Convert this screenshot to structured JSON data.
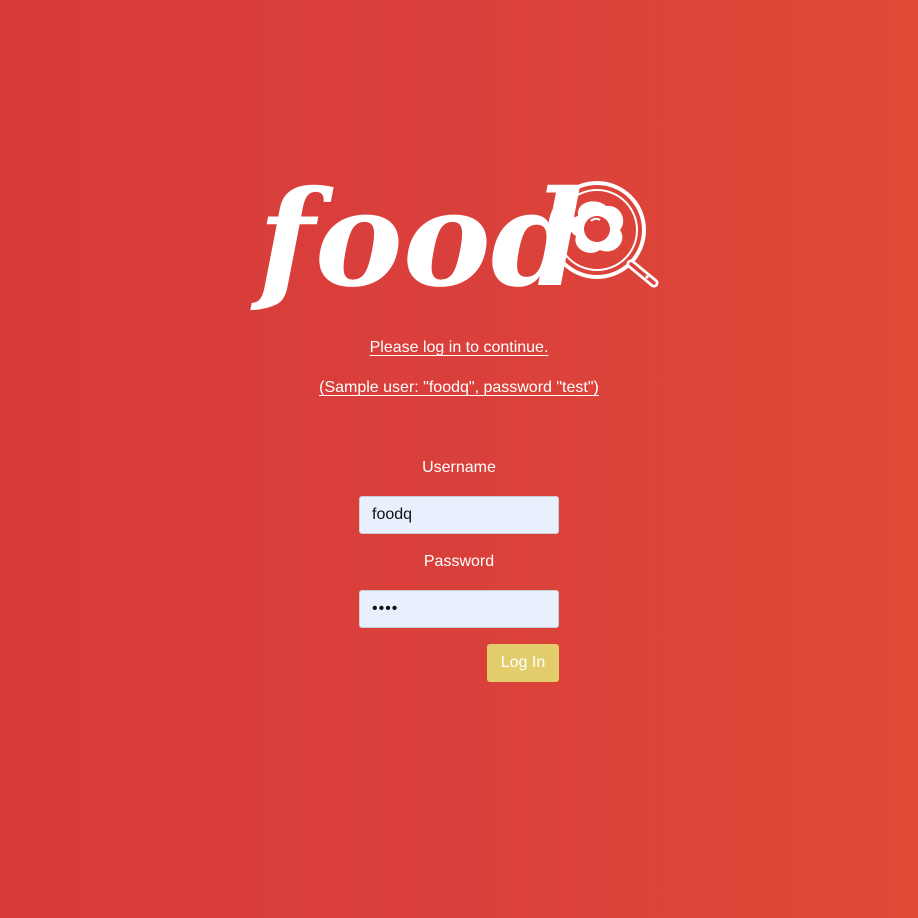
{
  "logo": {
    "text": "food",
    "icon": "frying-pan-egg-icon"
  },
  "messages": {
    "login_prompt": "Please log in to continue.",
    "sample_user": "(Sample user: \"foodq\", password \"test\")"
  },
  "form": {
    "username_label": "Username",
    "username_value": "foodq",
    "password_label": "Password",
    "password_value": "test",
    "submit_label": "Log In"
  },
  "colors": {
    "background_start": "#d63a3a",
    "background_end": "#e04a37",
    "button": "#e2cc6c",
    "input_background": "#e8f0fe"
  }
}
